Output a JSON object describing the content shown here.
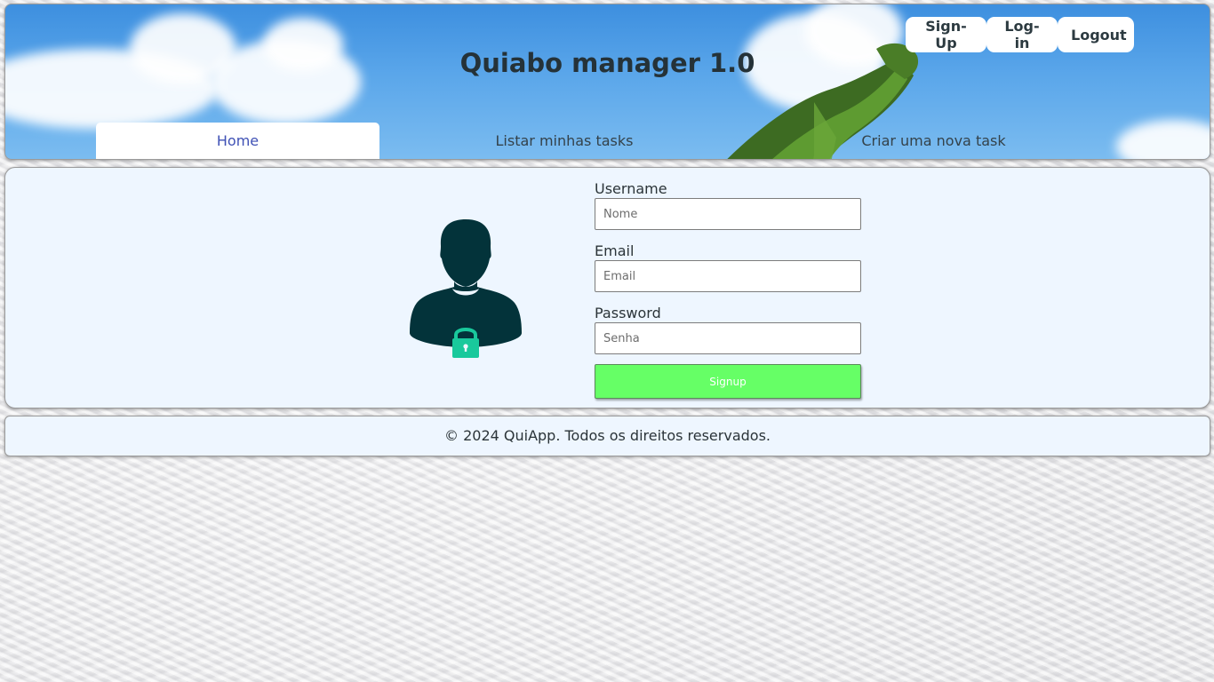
{
  "header": {
    "title": "Quiabo manager 1.0",
    "auth_buttons": {
      "signup": "Sign-Up",
      "login": "Log-in",
      "logout": "Logout"
    },
    "tabs": [
      {
        "label": "Home",
        "active": true
      },
      {
        "label": "Listar minhas tasks",
        "active": false
      },
      {
        "label": "Criar uma nova task",
        "active": false
      }
    ]
  },
  "form": {
    "username": {
      "label": "Username",
      "placeholder": "Nome",
      "value": ""
    },
    "email": {
      "label": "Email",
      "placeholder": "Email",
      "value": ""
    },
    "password": {
      "label": "Password",
      "placeholder": "Senha",
      "value": ""
    },
    "submit_label": "Signup"
  },
  "icons": {
    "avatar": "user-lock-icon"
  },
  "footer": {
    "text": "© 2024 QuiApp. Todos os direitos reservados."
  },
  "colors": {
    "accent_tab": "#3f51b5",
    "submit_button": "#66ff66",
    "panel_background": "#eef6ff",
    "avatar_dark": "#03333a",
    "lock_green": "#19c99c"
  }
}
